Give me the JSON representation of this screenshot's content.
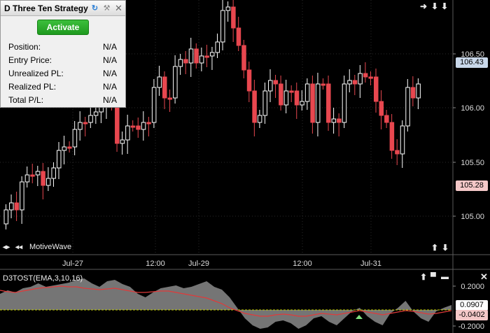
{
  "strategy_panel": {
    "title": "D Three Ten Strategy",
    "activate_label": "Activate",
    "rows": [
      {
        "label": "Position:",
        "value": "N/A"
      },
      {
        "label": "Entry Price:",
        "value": "N/A"
      },
      {
        "label": "Unrealized PL:",
        "value": "N/A"
      },
      {
        "label": "Realized PL:",
        "value": "N/A"
      },
      {
        "label": "Total P/L:",
        "value": "N/A"
      }
    ]
  },
  "price_axis": {
    "ticks": [
      "106.50",
      "106.00",
      "105.50",
      "105.00"
    ],
    "current_price": "106.43",
    "marker_price": "105.28"
  },
  "time_axis": {
    "ticks": [
      "Jul-27",
      "12:00",
      "Jul-29",
      "12:00",
      "Jul-31"
    ]
  },
  "watermark": {
    "label": "MotiveWave"
  },
  "indicator": {
    "title": "D3TOST(EMA,3,10,16)",
    "ticks": [
      "0.2000",
      "-0.2000"
    ],
    "value_tag": "0.0907",
    "signal_tag": "-0.0402"
  },
  "colors": {
    "background": "#000000",
    "up_candle": "#ffffff",
    "down_candle": "#e8474f",
    "grid": "#3a3a3a",
    "signal_line": "#e03a3a",
    "zero_line": "#c8d200",
    "fill": "#8a8a8a",
    "activate": "#2fae2f"
  }
}
